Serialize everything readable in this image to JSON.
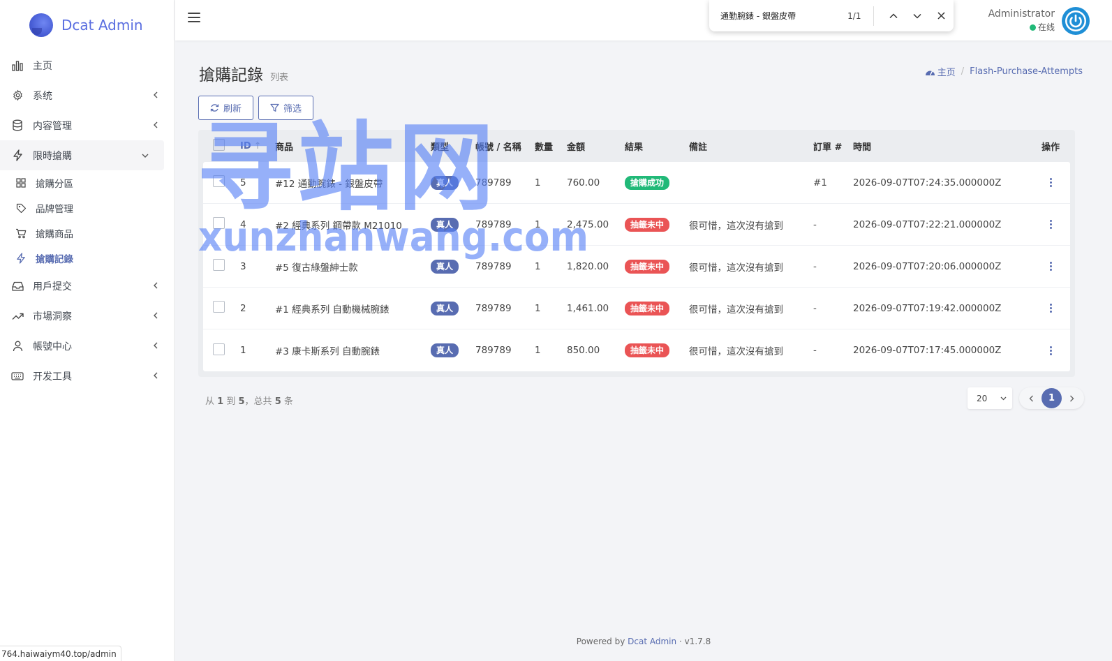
{
  "brand": {
    "name": "Dcat Admin"
  },
  "sidebar": {
    "items": [
      {
        "label": "主页",
        "icon": "bar-chart-icon",
        "has_children": false
      },
      {
        "label": "系统",
        "icon": "gear-icon",
        "has_children": true
      },
      {
        "label": "内容管理",
        "icon": "database-icon",
        "has_children": true
      },
      {
        "label": "限時搶購",
        "icon": "lightning-icon",
        "has_children": true,
        "open": true,
        "children": [
          {
            "label": "搶購分區",
            "icon": "grid-icon"
          },
          {
            "label": "品牌管理",
            "icon": "tag-icon"
          },
          {
            "label": "搶購商品",
            "icon": "cart-icon"
          },
          {
            "label": "搶購記錄",
            "icon": "lightning-icon",
            "active": true
          }
        ]
      },
      {
        "label": "用戶提交",
        "icon": "inbox-icon",
        "has_children": true
      },
      {
        "label": "市場洞察",
        "icon": "trend-icon",
        "has_children": true
      },
      {
        "label": "帳號中心",
        "icon": "user-icon",
        "has_children": true
      },
      {
        "label": "开发工具",
        "icon": "keyboard-icon",
        "has_children": true
      }
    ]
  },
  "status_url": "764.haiwaiym40.top/admin",
  "topbar": {
    "user_name": "Administrator",
    "user_status": "在线"
  },
  "findbar": {
    "query": "通勤腕錶 - 銀盤皮帶",
    "count": "1/1"
  },
  "page": {
    "title": "搶購記錄",
    "subtitle": "列表",
    "breadcrumb": {
      "home": "主页",
      "current": "Flash-Purchase-Attempts"
    }
  },
  "toolbar": {
    "refresh_label": "刷新",
    "filter_label": "筛选"
  },
  "table": {
    "headers": {
      "id": "ID",
      "product": "商品",
      "type": "類型",
      "account": "帳號 / 名稱",
      "qty": "數量",
      "amount": "金額",
      "result": "結果",
      "note": "備註",
      "order": "訂單 #",
      "time": "時間",
      "op": "操作"
    },
    "rows": [
      {
        "id": "5",
        "product": "#12 通勤腕錶 - 銀盤皮帶",
        "type": "真人",
        "account": "789789",
        "qty": "1",
        "amount": "760.00",
        "result": "搶購成功",
        "result_kind": "success",
        "note": "",
        "order": "#1",
        "time": "2026-09-07T07:24:35.000000Z"
      },
      {
        "id": "4",
        "product": "#2 經典系列 鋼帶款 M21010",
        "type": "真人",
        "account": "789789",
        "qty": "1",
        "amount": "2,475.00",
        "result": "抽籤未中",
        "result_kind": "fail",
        "note": "很可惜，這次沒有搶到",
        "order": "-",
        "time": "2026-09-07T07:22:21.000000Z"
      },
      {
        "id": "3",
        "product": "#5 復古綠盤紳士款",
        "type": "真人",
        "account": "789789",
        "qty": "1",
        "amount": "1,820.00",
        "result": "抽籤未中",
        "result_kind": "fail",
        "note": "很可惜，這次沒有搶到",
        "order": "-",
        "time": "2026-09-07T07:20:06.000000Z"
      },
      {
        "id": "2",
        "product": "#1 經典系列 自動機械腕錶",
        "type": "真人",
        "account": "789789",
        "qty": "1",
        "amount": "1,461.00",
        "result": "抽籤未中",
        "result_kind": "fail",
        "note": "很可惜，這次沒有搶到",
        "order": "-",
        "time": "2026-09-07T07:19:42.000000Z"
      },
      {
        "id": "1",
        "product": "#3 康卡斯系列 自動腕錶",
        "type": "真人",
        "account": "789789",
        "qty": "1",
        "amount": "850.00",
        "result": "抽籤未中",
        "result_kind": "fail",
        "note": "很可惜，這次沒有搶到",
        "order": "-",
        "time": "2026-09-07T07:17:45.000000Z"
      }
    ]
  },
  "pagination": {
    "info_prefix": "从",
    "from": "1",
    "info_to": "到",
    "to": "5",
    "info_total": "，总共",
    "total": "5",
    "info_suffix": "条",
    "per_page": "20",
    "current_page": "1"
  },
  "footer": {
    "powered_prefix": "Powered by",
    "powered_link": "Dcat Admin",
    "version": "· v1.7.8"
  },
  "watermark": {
    "big": "寻站网",
    "small": "xunzhanwang.com"
  },
  "colors": {
    "primary": "#586cb1",
    "success": "#21b978",
    "danger": "#ea5455",
    "watermark": "#5680f6"
  }
}
